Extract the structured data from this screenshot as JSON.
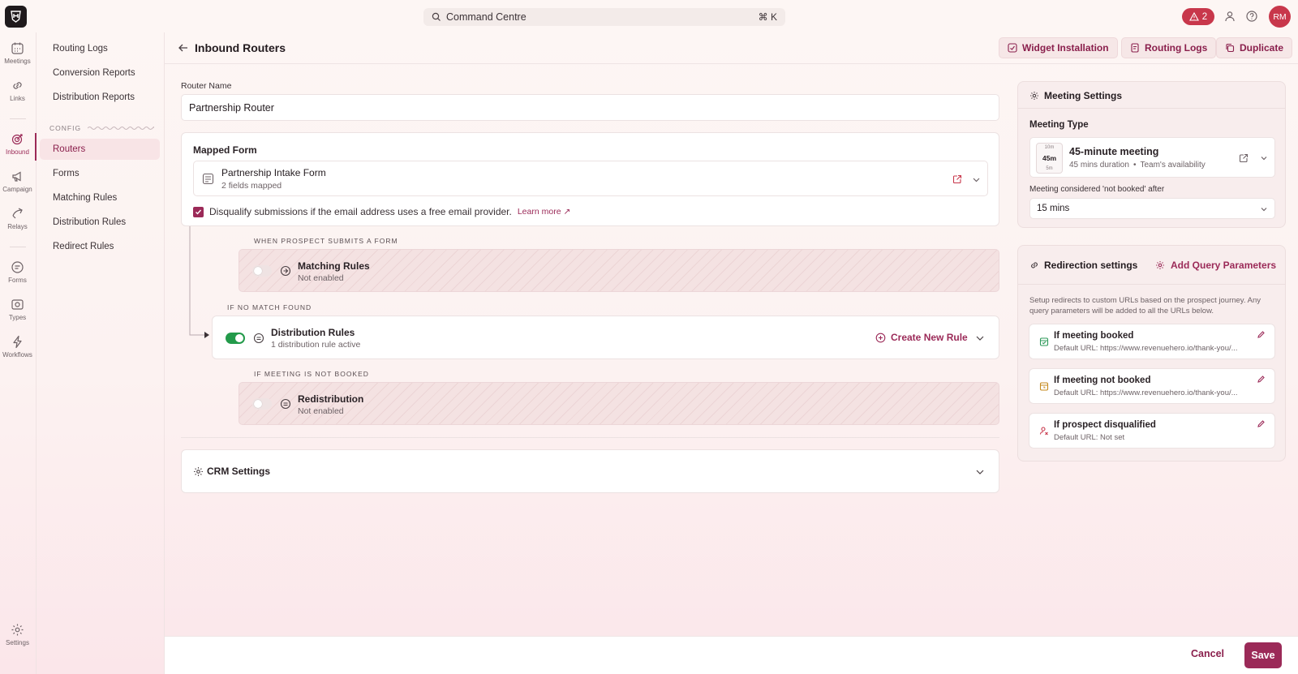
{
  "topbar": {
    "search_label": "Command Centre",
    "shortcut": "⌘ K",
    "alerts_count": "2",
    "avatar_initials": "RM"
  },
  "rail": {
    "items": [
      {
        "label": "Meetings",
        "icon": "calendar-icon"
      },
      {
        "label": "Links",
        "icon": "link-icon"
      },
      {
        "label": "Inbound",
        "icon": "target-icon"
      },
      {
        "label": "Campaign",
        "icon": "megaphone-icon"
      },
      {
        "label": "Relays",
        "icon": "relay-icon"
      },
      {
        "label": "Forms",
        "icon": "form-icon"
      },
      {
        "label": "Types",
        "icon": "types-icon"
      },
      {
        "label": "Workflows",
        "icon": "bolt-icon"
      },
      {
        "label": "Settings",
        "icon": "gear-icon"
      }
    ],
    "active": "Inbound"
  },
  "subnav": {
    "items_top": [
      "Routing Logs",
      "Conversion Reports",
      "Distribution Reports"
    ],
    "config_label": "CONFIG",
    "items_config": [
      "Routers",
      "Forms",
      "Matching Rules",
      "Distribution Rules",
      "Redirect Rules"
    ],
    "active": "Routers"
  },
  "header": {
    "title": "Inbound Routers",
    "buttons": [
      "Widget Installation",
      "Routing Logs",
      "Duplicate"
    ]
  },
  "router": {
    "name_label": "Router Name",
    "name_value": "Partnership Router",
    "mapped_form_label": "Mapped Form",
    "form_name": "Partnership Intake Form",
    "form_meta": "2 fields mapped",
    "disqualify_text": "Disqualify submissions if the email address uses a free email provider.",
    "disqualify_checked": true,
    "learn_more": "Learn more ↗"
  },
  "flow": {
    "when_submits": "WHEN PROSPECT SUBMITS A FORM",
    "matching": {
      "title": "Matching Rules",
      "status": "Not enabled",
      "enabled": false
    },
    "if_no_match": "IF NO MATCH FOUND",
    "distribution": {
      "title": "Distribution Rules",
      "status": "1 distribution rule active",
      "enabled": true,
      "action": "Create New Rule"
    },
    "if_not_booked": "IF MEETING IS NOT BOOKED",
    "redistribution": {
      "title": "Redistribution",
      "status": "Not enabled",
      "enabled": false
    }
  },
  "crm": {
    "title": "CRM Settings"
  },
  "meeting_settings": {
    "title": "Meeting Settings",
    "type_label": "Meeting Type",
    "thumb": {
      "top": "10m",
      "mid": "45m",
      "bottom": "5m"
    },
    "meeting_name": "45-minute meeting",
    "meeting_duration": "45 mins duration",
    "meeting_avail": "Team's availability",
    "not_booked_label": "Meeting considered 'not booked' after",
    "not_booked_value": "15 mins"
  },
  "redirection": {
    "title": "Redirection settings",
    "add_params": "Add Query Parameters",
    "description": "Setup redirects to custom URLs based on the prospect journey. Any query parameters will be added to all the URLs below.",
    "items": [
      {
        "title": "If meeting booked",
        "url": "Default URL:  https://www.revenuehero.io/thank-you/...",
        "color": "#2e9a5a"
      },
      {
        "title": "If meeting not booked",
        "url": "Default URL:  https://www.revenuehero.io/thank-you/...",
        "color": "#c58a1e"
      },
      {
        "title": "If prospect disqualified",
        "url": "Default URL:  Not set",
        "color": "#c8374b"
      }
    ]
  },
  "footer": {
    "cancel": "Cancel",
    "save": "Save"
  },
  "colors": {
    "brand": "#9b2a58",
    "alert": "#c8374b",
    "toggle_on": "#239a4a"
  }
}
